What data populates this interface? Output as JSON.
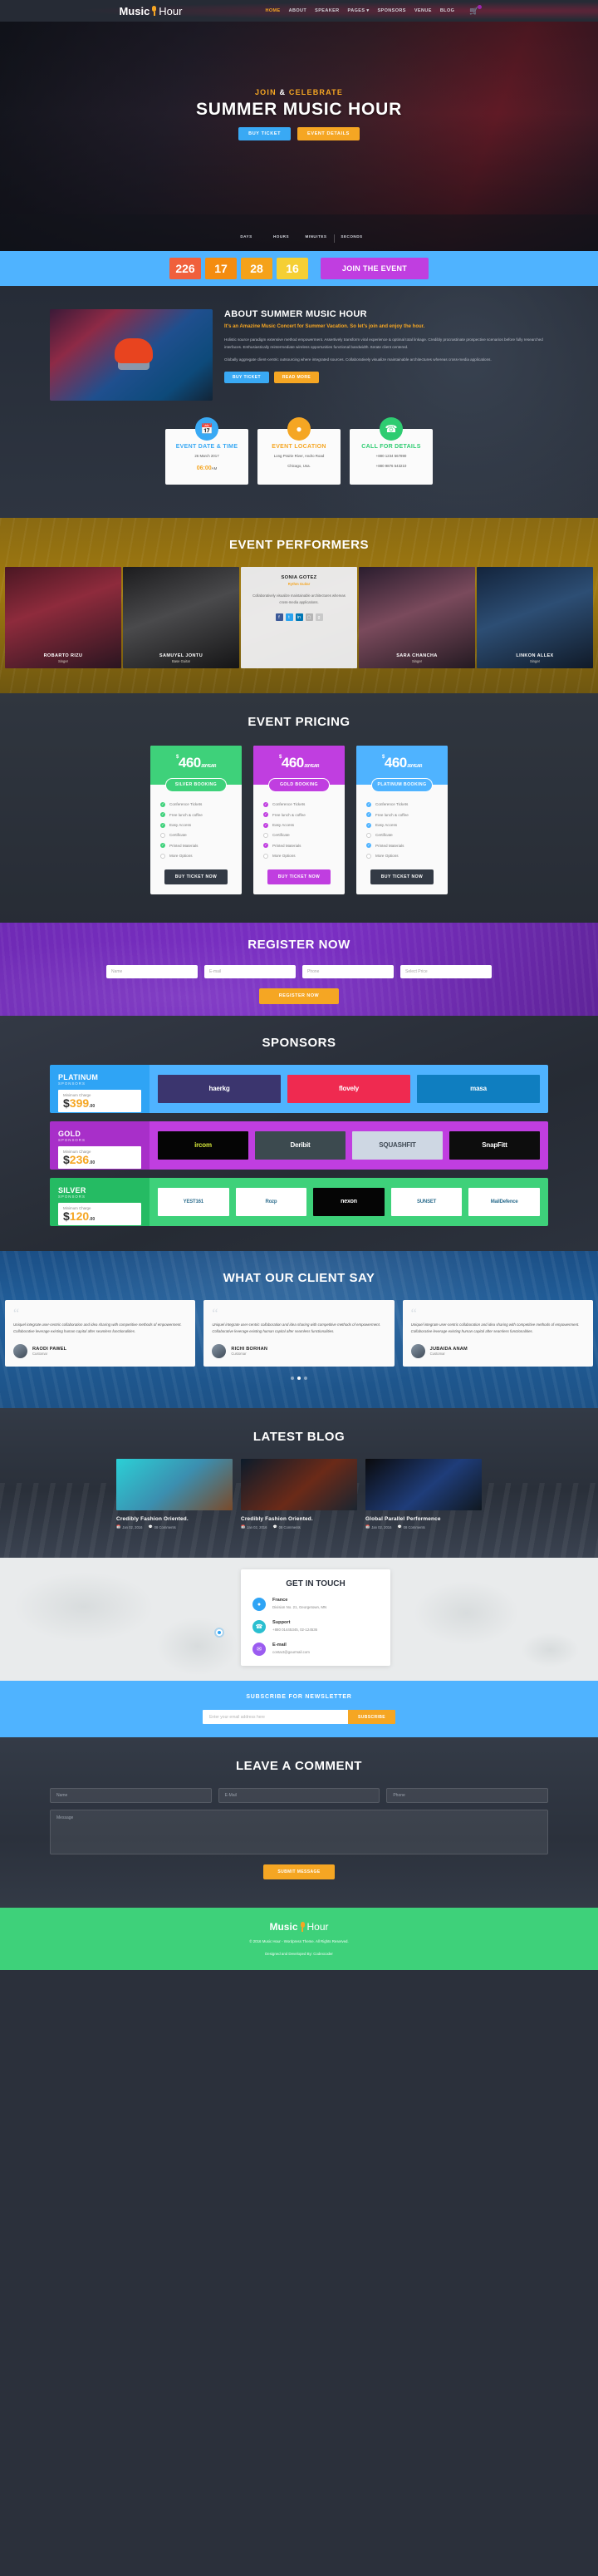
{
  "header": {
    "logo": {
      "part1": "Music",
      "part2": "Hour",
      "icon": "microphone-icon"
    },
    "nav": [
      {
        "label": "HOME",
        "active": true
      },
      {
        "label": "ABOUT",
        "active": false
      },
      {
        "label": "SPEAKER",
        "active": false
      },
      {
        "label": "PAGES ▾",
        "active": false
      },
      {
        "label": "SPONSORS",
        "active": false
      },
      {
        "label": "VENUE",
        "active": false
      },
      {
        "label": "BLOG",
        "active": false
      }
    ],
    "cart_icon": "shopping-cart-icon"
  },
  "hero": {
    "subtitle_a": "JOIN ",
    "subtitle_amp": "&",
    "subtitle_b": " CELEBRATE",
    "title": "SUMMER MUSIC HOUR",
    "btn_primary": "BUY TICKET",
    "btn_secondary": "EVENT DETAILS",
    "countdown_labels": [
      "DAYS",
      "HOURS",
      "MINUITES",
      "SECONDS"
    ]
  },
  "countdown": {
    "values": [
      "226",
      "17",
      "28",
      "16"
    ],
    "join_label": "JOIN THE EVENT"
  },
  "about": {
    "title": "ABOUT SUMMER MUSIC HOUR",
    "lead": "It's an Amazine Music Concert for Summer Vacation. So let's join and enjoy the hour.",
    "paragraph1": "Holistic source paradigm extensive method empowerment. Assertively transform viral experience & optimal total linkage. Credibly procrastinate prospective scenarios before fully researched interfaces. Enthusiastically reintermediate wireless opportunities functional bandwidth. Iterate client centered.",
    "paragraph2": "Globally aggregate client-centric outsourcing where integrated sources. Collaboratively visualize maintainable architectures whereas cross-media applications.",
    "btn_primary": "BUY TICKET",
    "btn_secondary": "READ MORE",
    "cards": [
      {
        "icon": "calendar-icon",
        "title": "EVENT DATE & TIME",
        "line1": "26 March 2017",
        "time": "06:00",
        "ampm": "AM",
        "color": "#39a9f4"
      },
      {
        "icon": "location-pin-icon",
        "title": "EVENT LOCATION",
        "line1": "Long Prairie River, Andro Road",
        "line2": "Chicago, Usa.",
        "color": "#f5a623"
      },
      {
        "icon": "telephone-icon",
        "title": "CALL FOR DETAILS",
        "line1": "+880 1234 567890",
        "line2": "+880 9876 543210",
        "color": "#2ecc71"
      }
    ]
  },
  "performers": {
    "title": "EVENT PERFORMERS",
    "items": [
      {
        "name": "ROBARTO RIZU",
        "role": "Singer",
        "active": false
      },
      {
        "name": "SAMUYEL JONTU",
        "role": "Base Guitar",
        "active": false
      },
      {
        "name": "SONIA GOTEZ",
        "role": "Rythm Guitar",
        "active": true,
        "bio": "Collaboratively visualize maintainable architectures whereas cross-media applications.",
        "socials": [
          "facebook-icon",
          "twitter-icon",
          "linkedin-icon",
          "instagram-icon",
          "google-plus-icon"
        ]
      },
      {
        "name": "SARA CHANCHA",
        "role": "Singer",
        "active": false
      },
      {
        "name": "LINKON ALLEX",
        "role": "Singer",
        "active": false
      }
    ]
  },
  "pricing": {
    "title": "EVENT PRICING",
    "plans": [
      {
        "currency": "$",
        "amount": "460",
        "cents": ".00/YEAR",
        "tag": "SILVER BOOKING",
        "color": "#3ed17a",
        "features": [
          {
            "label": "Conference Tickets",
            "included": true
          },
          {
            "label": "Free lunch & coffee",
            "included": true
          },
          {
            "label": "Easy Access",
            "included": true
          },
          {
            "label": "Certificate",
            "included": false
          },
          {
            "label": "Printed Materials",
            "included": true
          },
          {
            "label": "More Options",
            "included": false
          }
        ],
        "button": "BUY TICKET NOW"
      },
      {
        "currency": "$",
        "amount": "460",
        "cents": ".00/YEAR",
        "tag": "GOLD BOOKING",
        "color": "#c03ee0",
        "features": [
          {
            "label": "Conference Tickets",
            "included": true
          },
          {
            "label": "Free lunch & coffee",
            "included": true
          },
          {
            "label": "Easy Access",
            "included": true
          },
          {
            "label": "Certificate",
            "included": false
          },
          {
            "label": "Printed Materials",
            "included": true
          },
          {
            "label": "More Options",
            "included": false
          }
        ],
        "button": "BUY TICKET NOW"
      },
      {
        "currency": "$",
        "amount": "460",
        "cents": ".00/YEAR",
        "tag": "PLATINUM BOOKING",
        "color": "#4fb3ff",
        "features": [
          {
            "label": "Conference Tickets",
            "included": true
          },
          {
            "label": "Free lunch & coffee",
            "included": true
          },
          {
            "label": "Easy Access",
            "included": true
          },
          {
            "label": "Certificate",
            "included": false
          },
          {
            "label": "Printed Materials",
            "included": true
          },
          {
            "label": "More Options",
            "included": false
          }
        ],
        "button": "BUY TICKET NOW"
      }
    ]
  },
  "register": {
    "title": "REGISTER NOW",
    "fields": [
      {
        "placeholder": "Name"
      },
      {
        "placeholder": "E-mail"
      },
      {
        "placeholder": "Phone"
      },
      {
        "placeholder": "Select Price"
      }
    ],
    "button": "REGISTER NOW"
  },
  "sponsors": {
    "title": "SPONSORS",
    "tiers": [
      {
        "name": "PLATINUM",
        "sub": "SPONSORS",
        "charge_label": "Minimum Charge",
        "currency": "$",
        "amount": "399",
        "cents": ".00",
        "logos": [
          "haerkg",
          "flovely",
          "masa"
        ]
      },
      {
        "name": "GOLD",
        "sub": "SPONSORS",
        "charge_label": "Minimum Charge",
        "currency": "$",
        "amount": "236",
        "cents": ".00",
        "logos": [
          "ircom",
          "Deribit",
          "SQUASHFIT",
          "SnapFitt"
        ]
      },
      {
        "name": "SILVER",
        "sub": "SPONSORS",
        "charge_label": "Minimum Charge",
        "currency": "$",
        "amount": "120",
        "cents": ".00",
        "logos": [
          "YEST161",
          "Rozp",
          "nexon",
          "SUNSET",
          "MailDefence"
        ]
      }
    ]
  },
  "testimonials": {
    "title": "WHAT OUR CLIENT SAY",
    "items": [
      {
        "quote": "Uniquel integrate user-centric collaboration and idea sharing with competitive methods of empowerment. Collaborative leverage existing human capital after seamless functionalities.",
        "name": "RAODI PAWEL",
        "role": "Customar"
      },
      {
        "quote": "Uniquel integrate user-centric collaboration and idea sharing with competitive methods of empowerment. Collaborative leverage existing human capital after seamless functionalities.",
        "name": "RICHI BORHAN",
        "role": "Customar"
      },
      {
        "quote": "Uniquel integrate user-centric collaboration and idea sharing with competitive methods of empowerment. Collaborative leverage existing human capital after seamless functionalities.",
        "name": "JUBAIDA ANAM",
        "role": "Customar"
      }
    ],
    "dots": 3,
    "active_dot": 1
  },
  "blog": {
    "title": "LATEST BLOG",
    "posts": [
      {
        "title": "Credibly Fashion Oriented.",
        "date": "Jan 02, 2016",
        "comments": "08 Comments"
      },
      {
        "title": "Credibly Fashion Oriented.",
        "date": "Jan 02, 2016",
        "comments": "08 Comments"
      },
      {
        "title": "Global Parallel Performence",
        "date": "Jan 02, 2016",
        "comments": "08 Comments"
      }
    ]
  },
  "contact": {
    "title": "GET IN TOUCH",
    "items": [
      {
        "icon": "location-pin-icon",
        "title": "France",
        "detail": "Division No. 21, Georgetown, MN"
      },
      {
        "icon": "phone-icon",
        "title": "Support",
        "detail": "+880 01445345, 02-124536"
      },
      {
        "icon": "envelope-icon",
        "title": "E-mail",
        "detail": "contact@gourmail.com"
      }
    ]
  },
  "newsletter": {
    "title": "SUBSCRIBE FOR NEWSLETTER",
    "placeholder": "Enter your email address here",
    "button": "SUBSCRIBE"
  },
  "comment": {
    "title": "LEAVE A COMMENT",
    "fields": [
      {
        "placeholder": "Name"
      },
      {
        "placeholder": "E-Mail"
      },
      {
        "placeholder": "Phone"
      }
    ],
    "message_placeholder": "Message",
    "button": "SUBMIT MESSAGE"
  },
  "footer": {
    "logo_part1": "Music",
    "logo_part2": "Hour",
    "copyright": "© 2016 Music Hour - Wordpress Theme. All Rights Reserved.",
    "credit": "Designed and Developed By: Codexcoder"
  }
}
